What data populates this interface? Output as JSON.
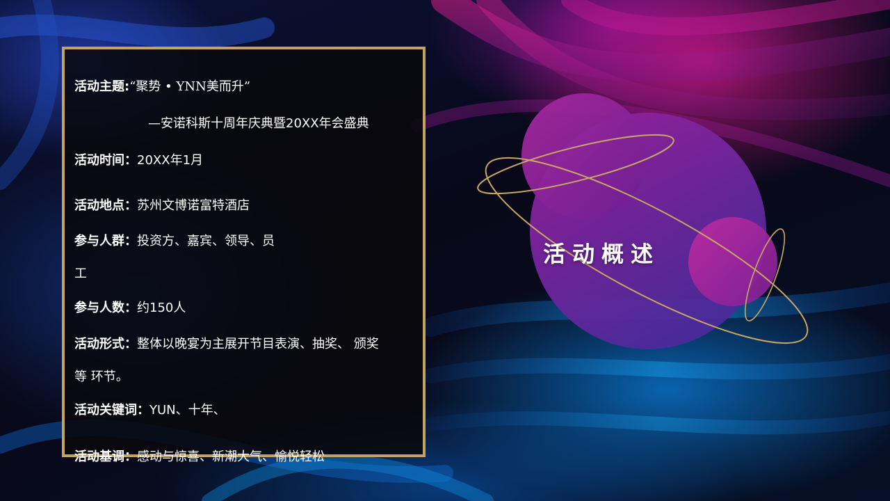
{
  "colors": {
    "frame_gold": "#c2a360",
    "planet_purple": "#8a1f9a",
    "planet_magenta": "#b0289a",
    "orbit_gold": "#c9a864"
  },
  "section_title": "活动概述",
  "info": {
    "theme": {
      "label": "活动主题:",
      "value": "“聚势 • YNN美而升”"
    },
    "subtitle": "—安诺科斯十周年庆典暨20XX年会盛典",
    "time": {
      "label": "活动时间：",
      "value": "20XX年1月"
    },
    "place": {
      "label": "活动地点：",
      "value": "苏州文博诺富特酒店"
    },
    "audience": {
      "label": "参与人群：",
      "value": "投资方、嘉宾、领导、员",
      "value_wrap": "工"
    },
    "count": {
      "label": "参与人数：",
      "value": "约150人"
    },
    "format": {
      "label": "活动形式：",
      "value": "整体以晚宴为主展开节目表演、抽奖、 颁奖",
      "value_wrap": "等 环节。"
    },
    "keywords": {
      "label": "活动关键词：",
      "value": "YUN、十年、"
    },
    "tone": {
      "label": "活动基调：",
      "value": "感动与惊喜、新潮大气、愉悦轻松"
    }
  }
}
